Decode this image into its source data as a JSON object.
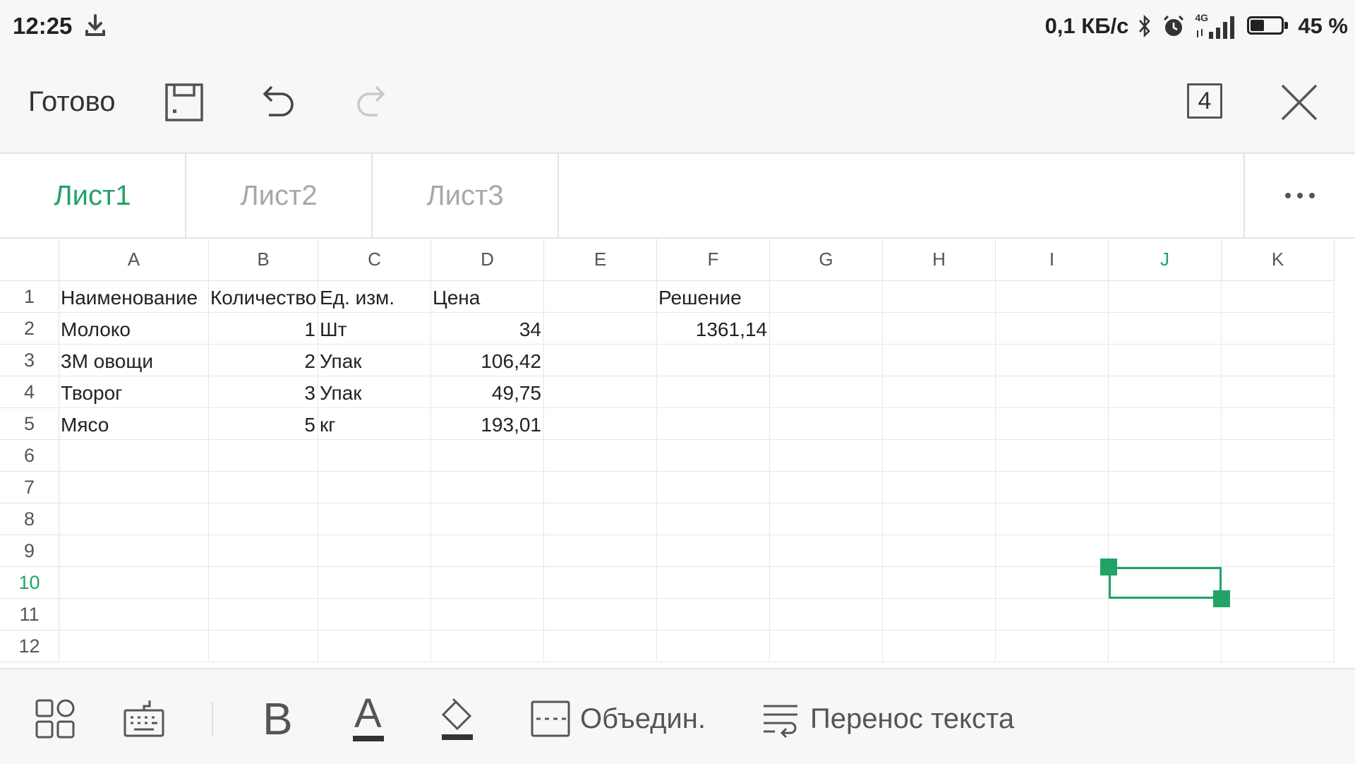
{
  "status_bar": {
    "time": "12:25",
    "net_speed": "0,1 КБ/с",
    "network_type": "4G",
    "battery_percent": "45 %",
    "battery_level": 0.45,
    "icons": [
      "download-icon",
      "bluetooth-icon",
      "alarm-icon",
      "signal-icon",
      "battery-icon"
    ]
  },
  "toolbar": {
    "done_label": "Готово",
    "sheet_count": "4",
    "icons": [
      "save-icon",
      "undo-icon",
      "redo-icon",
      "close-icon"
    ]
  },
  "sheets": {
    "tabs": [
      {
        "label": "Лист1",
        "active": true
      },
      {
        "label": "Лист2",
        "active": false
      },
      {
        "label": "Лист3",
        "active": false
      }
    ],
    "more_icon": "more-icon"
  },
  "grid": {
    "columns": [
      "A",
      "B",
      "C",
      "D",
      "E",
      "F",
      "G",
      "H",
      "I",
      "J",
      "K"
    ],
    "rows": [
      "1",
      "2",
      "3",
      "4",
      "5",
      "6",
      "7",
      "8",
      "9",
      "10",
      "11",
      "12"
    ],
    "selected_column": "J",
    "selected_row": "10",
    "cells": {
      "A1": "Наименование",
      "B1": "Количество",
      "C1": "Ед. изм.",
      "D1": "Цена",
      "F1": "Решение",
      "A2": "Молоко",
      "B2": "1",
      "C2": "Шт",
      "D2": "34",
      "F2": "1361,14",
      "A3": "3М овощи",
      "B3": "2",
      "C3": "Упак",
      "D3": "106,42",
      "A4": "Творог",
      "B4": "3",
      "C4": "Упак",
      "D4": "49,75",
      "A5": "Мясо",
      "B5": "5",
      "C5": "кг",
      "D5": "193,01"
    }
  },
  "format_bar": {
    "merge_label": "Объедин.",
    "wrap_label": "Перенос текста",
    "bold_glyph": "B",
    "font_color_glyph": "A",
    "icons": [
      "layout-icon",
      "keyboard-icon",
      "bold-icon",
      "font-color-icon",
      "fill-color-icon",
      "merge-icon",
      "wrap-text-icon"
    ]
  },
  "colors": {
    "accent": "#21a366",
    "bar_bg": "#f7f7f7",
    "grid_line": "#e6e6e6"
  }
}
